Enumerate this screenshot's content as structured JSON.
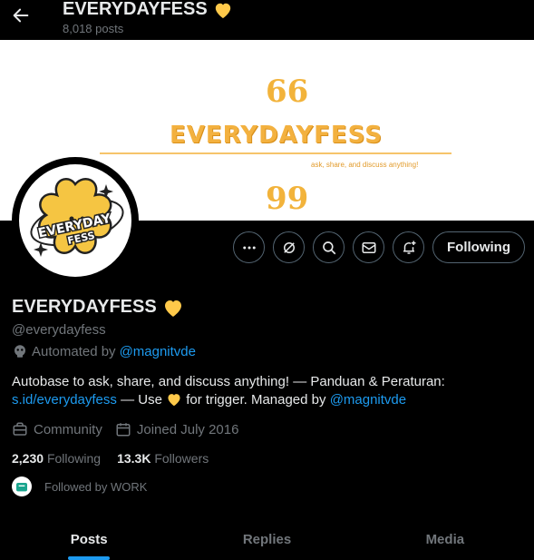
{
  "header": {
    "title": "EVERYDAYFESS",
    "posts_count": "8,018 posts",
    "back_icon": "arrow-left-icon"
  },
  "banner": {
    "title": "EVERYDAYFESS",
    "tagline": "ask, share, and discuss anything!",
    "quote_open": "66",
    "quote_close": "99"
  },
  "avatar": {
    "top_text": "EVERYDAY",
    "bottom_text": "FESS"
  },
  "actions": {
    "follow_label": "Following",
    "icons": [
      "more-icon",
      "grok-icon",
      "search-icon",
      "message-icon",
      "notify-icon"
    ]
  },
  "profile": {
    "name": "EVERYDAYFESS",
    "handle": "@everydayfess",
    "automated_prefix": "Automated by",
    "automated_link": "@magnitvde",
    "bio_line1": "Autobase to ask, share, and discuss anything! — Panduan & Peraturan:",
    "bio_link": "s.id/everydayfess",
    "bio_mid": "— Use",
    "bio_after": "for trigger. Managed by",
    "bio_manager": "@magnitvde",
    "category": "Community",
    "joined": "Joined July 2016",
    "following_count": "2,230",
    "following_label": "Following",
    "followers_count": "13.3K",
    "followers_label": "Followers",
    "followed_by": "Followed by WORK"
  },
  "tabs": [
    {
      "label": "Posts",
      "active": true
    },
    {
      "label": "Replies",
      "active": false
    },
    {
      "label": "Media",
      "active": false
    }
  ],
  "colors": {
    "accent": "#1d9bf0",
    "heart": "#ffc107",
    "banner_text": "#f3b13f"
  }
}
